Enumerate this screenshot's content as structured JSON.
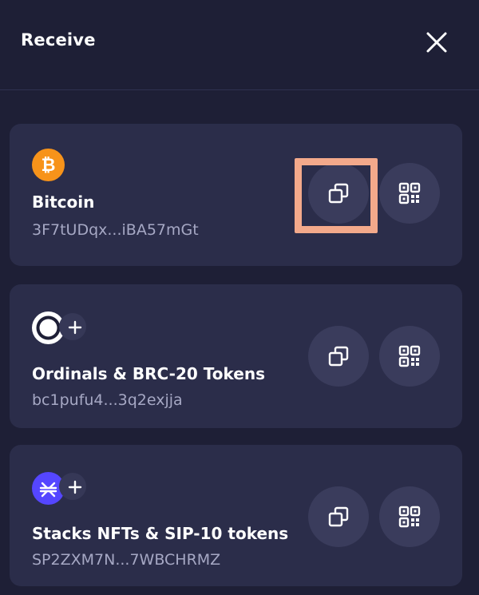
{
  "header": {
    "title": "Receive"
  },
  "accounts": [
    {
      "name": "Bitcoin",
      "address": "3F7tUDqx...iBA57mGt",
      "icon": "bitcoin-icon",
      "color": "#f7931a"
    },
    {
      "name": "Ordinals & BRC-20 Tokens",
      "address": "bc1pufu4...3q2exjja",
      "icon": "ordinals-icon",
      "color": "#ffffff"
    },
    {
      "name": "Stacks NFTs & SIP-10 tokens",
      "address": "SP2ZXM7N...7WBCHRMZ",
      "icon": "stacks-icon",
      "color": "#5546ff"
    }
  ],
  "actions": {
    "copy_icon": "copy-icon",
    "qr_icon": "qr-code-icon"
  },
  "highlight_color": "#f3a98b"
}
